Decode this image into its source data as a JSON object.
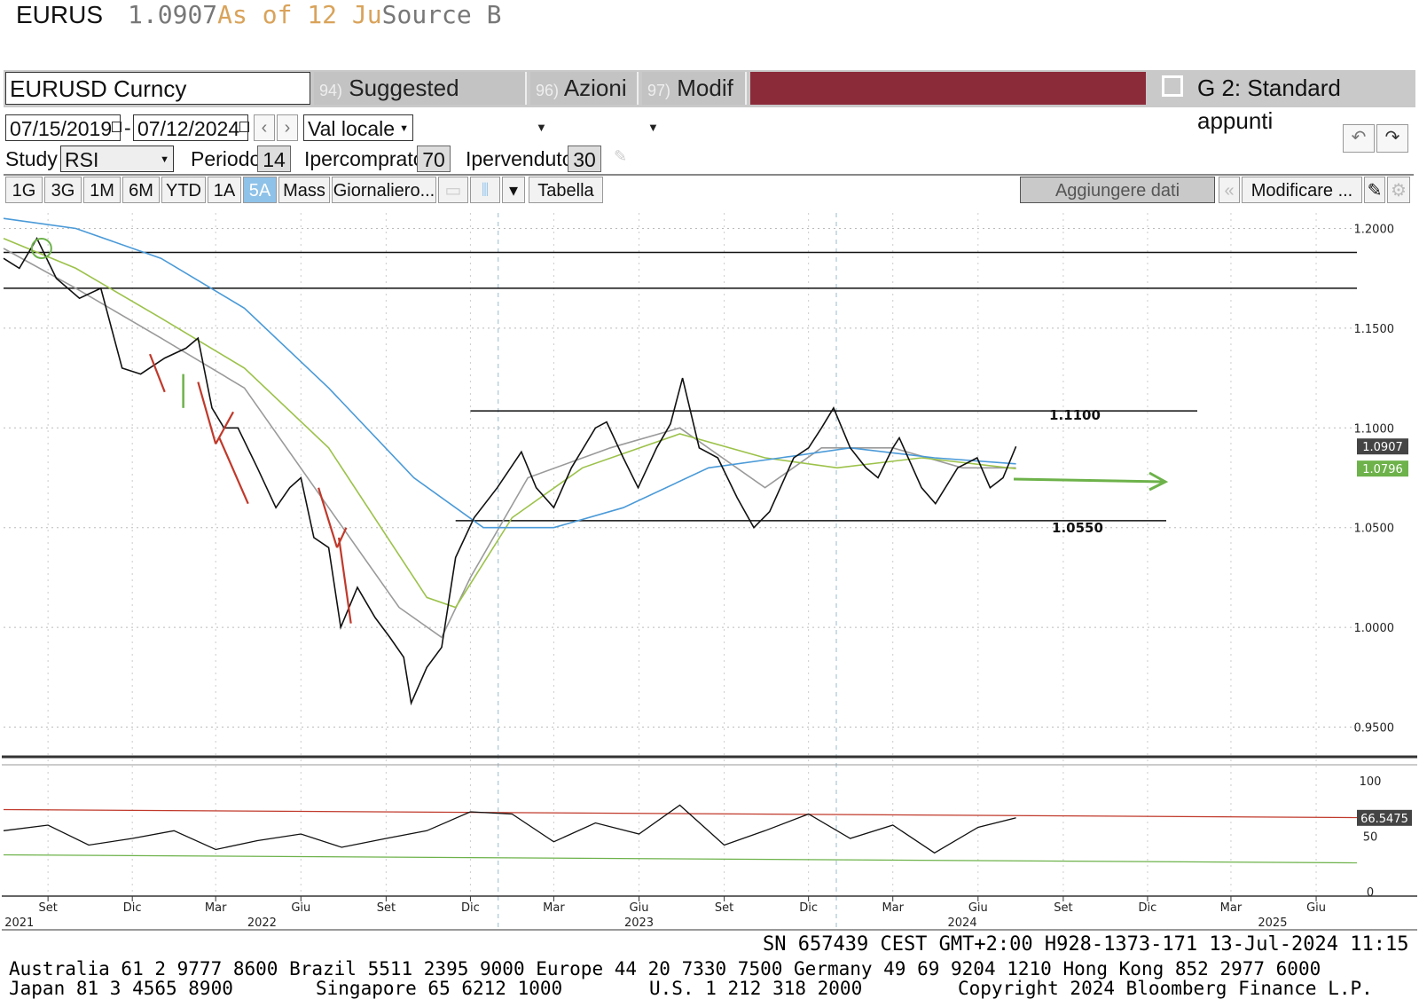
{
  "header": {
    "ticker": "EURUS",
    "price": "1.0907",
    "as_of": "As of 12 Ju",
    "source": "Source B"
  },
  "toolbar": {
    "security": "EURUSD Curncy",
    "suggested_num": "94)",
    "suggested": "Suggested Charts",
    "azioni_num": "96)",
    "azioni": "Azioni",
    "modif_num": "97)",
    "modif": "Modif",
    "template": "G 2: Standard appunti"
  },
  "controls": {
    "date_from": "07/15/2019",
    "date_to": "07/12/2024",
    "currency": "Val locale",
    "study_label": "Study",
    "study_value": "RSI",
    "periodo_label": "Periodo",
    "periodo_value": "14",
    "ipercomprato_label": "Ipercomprato",
    "ipercomprato_value": "70",
    "ipervenduto_label": "Ipervenduto",
    "ipervenduto_value": "30",
    "ranges": [
      "1G",
      "3G",
      "1M",
      "6M",
      "YTD",
      "1A",
      "5A",
      "Mass"
    ],
    "selected_range": "5A",
    "frequency": "Giornaliero...",
    "table": "Tabella",
    "add_data": "Aggiungere dati",
    "modify": "Modificare ..."
  },
  "chart_data": [
    {
      "type": "line",
      "title": "",
      "ylim": [
        0.94,
        1.21
      ],
      "y_ticks": [
        "1.2000",
        "1.1500",
        "1.1000",
        "1.0500",
        "1.0000",
        "0.9500"
      ],
      "y_tick_values": [
        1.2,
        1.15,
        1.1,
        1.05,
        1.0,
        0.95
      ],
      "x_ticks": [
        "Set",
        "Dic",
        "Mar",
        "Giu",
        "Set",
        "Dic",
        "Mar",
        "Giu",
        "Set",
        "Dic",
        "Mar",
        "Giu",
        "Set",
        "Dic",
        "Mar",
        "Giu"
      ],
      "x_tick_dates": [
        "2021-09-01",
        "2021-12-01",
        "2022-03-01",
        "2022-06-01",
        "2022-09-01",
        "2022-12-01",
        "2023-03-01",
        "2023-06-01",
        "2023-09-01",
        "2023-12-01",
        "2024-03-01",
        "2024-06-01",
        "2024-09-01",
        "2024-12-01",
        "2025-03-01",
        "2025-06-01"
      ],
      "years": [
        "2021",
        "2022",
        "2023",
        "2024",
        "2025"
      ],
      "year_dates": [
        "2021-08-01",
        "2022-04-20",
        "2023-06-01",
        "2024-05-15",
        "2025-04-15"
      ],
      "series": [
        {
          "x": [
            "2021-07-15",
            "2021-08-01",
            "2021-08-20",
            "2021-09-10",
            "2021-10-05",
            "2021-10-28",
            "2021-11-20",
            "2021-12-10",
            "2022-01-05",
            "2022-01-28",
            "2022-02-10",
            "2022-02-25",
            "2022-03-10",
            "2022-03-25",
            "2022-04-15",
            "2022-05-05",
            "2022-05-20",
            "2022-06-01",
            "2022-06-15",
            "2022-07-01",
            "2022-07-14",
            "2022-08-01",
            "2022-08-20",
            "2022-09-05",
            "2022-09-20",
            "2022-09-28",
            "2022-10-15",
            "2022-10-31",
            "2022-11-15",
            "2022-12-05",
            "2022-12-30",
            "2023-01-25",
            "2023-02-10",
            "2023-03-01",
            "2023-03-20",
            "2023-04-15",
            "2023-04-27",
            "2023-05-15",
            "2023-05-31",
            "2023-06-20",
            "2023-07-05",
            "2023-07-18",
            "2023-08-05",
            "2023-08-25",
            "2023-09-15",
            "2023-10-03",
            "2023-10-20",
            "2023-11-15",
            "2023-12-01",
            "2023-12-15",
            "2023-12-28",
            "2024-01-15",
            "2024-02-01",
            "2024-02-14",
            "2024-03-01",
            "2024-03-08",
            "2024-04-01",
            "2024-04-16",
            "2024-05-10",
            "2024-05-31",
            "2024-06-14",
            "2024-06-28",
            "2024-07-12"
          ],
          "values": [
            1.185,
            1.18,
            1.195,
            1.175,
            1.165,
            1.17,
            1.13,
            1.127,
            1.135,
            1.14,
            1.145,
            1.11,
            1.1,
            1.1,
            1.08,
            1.06,
            1.07,
            1.075,
            1.045,
            1.04,
            1.0,
            1.02,
            1.005,
            0.995,
            0.985,
            0.962,
            0.98,
            0.99,
            1.035,
            1.055,
            1.07,
            1.088,
            1.07,
            1.06,
            1.08,
            1.1,
            1.103,
            1.085,
            1.07,
            1.09,
            1.102,
            1.125,
            1.09,
            1.085,
            1.065,
            1.05,
            1.058,
            1.085,
            1.09,
            1.1,
            1.11,
            1.09,
            1.08,
            1.075,
            1.09,
            1.095,
            1.07,
            1.062,
            1.08,
            1.085,
            1.07,
            1.075,
            1.0907
          ]
        }
      ],
      "moving_averages": [
        {
          "color": "#9a9a9a",
          "x": [
            "2021-07-15",
            "2021-10-01",
            "2022-01-01",
            "2022-04-01",
            "2022-07-01",
            "2022-09-15",
            "2022-10-31",
            "2022-12-01",
            "2023-02-01",
            "2023-05-01",
            "2023-07-15",
            "2023-10-15",
            "2023-12-15",
            "2024-03-01",
            "2024-05-15",
            "2024-07-12"
          ],
          "values": [
            1.19,
            1.17,
            1.145,
            1.12,
            1.06,
            1.01,
            0.995,
            1.025,
            1.075,
            1.09,
            1.1,
            1.07,
            1.09,
            1.09,
            1.08,
            1.08
          ]
        },
        {
          "color": "#9cc24a",
          "x": [
            "2021-07-15",
            "2021-10-01",
            "2022-01-01",
            "2022-04-01",
            "2022-07-01",
            "2022-10-15",
            "2022-11-15",
            "2023-01-15",
            "2023-04-01",
            "2023-07-15",
            "2023-10-15",
            "2024-01-01",
            "2024-04-01",
            "2024-07-12"
          ],
          "values": [
            1.195,
            1.18,
            1.155,
            1.13,
            1.09,
            1.015,
            1.01,
            1.055,
            1.08,
            1.097,
            1.085,
            1.08,
            1.085,
            1.0796
          ]
        },
        {
          "color": "#4a9ad8",
          "x": [
            "2021-07-15",
            "2021-10-01",
            "2022-01-01",
            "2022-04-01",
            "2022-07-01",
            "2022-10-01",
            "2022-12-15",
            "2023-03-01",
            "2023-05-15",
            "2023-08-15",
            "2023-11-01",
            "2024-01-15",
            "2024-04-15",
            "2024-07-12"
          ],
          "values": [
            1.205,
            1.2,
            1.185,
            1.16,
            1.12,
            1.075,
            1.05,
            1.05,
            1.06,
            1.08,
            1.085,
            1.09,
            1.085,
            1.082
          ]
        }
      ],
      "levels": [
        {
          "label": "",
          "value": 1.188
        },
        {
          "label": "",
          "value": 1.17
        },
        {
          "label": "1.1100",
          "value": 1.1085
        },
        {
          "label": "1.0550",
          "value": 1.0535
        }
      ],
      "last_price_label": "1.0907",
      "ma_label": "1.0796",
      "last_price": 1.0907,
      "ma_value": 1.0796
    },
    {
      "type": "line",
      "title": "",
      "ylim": [
        0,
        100
      ],
      "y_ticks": [
        "100",
        "50",
        "0"
      ],
      "y_tick_values": [
        100,
        50,
        0
      ],
      "overbought": 70,
      "oversold": 30,
      "series": [
        {
          "x": [
            "2021-07-15",
            "2021-09-01",
            "2021-10-15",
            "2021-12-01",
            "2022-01-15",
            "2022-03-01",
            "2022-04-15",
            "2022-06-01",
            "2022-07-15",
            "2022-09-01",
            "2022-10-15",
            "2022-12-01",
            "2023-01-15",
            "2023-03-01",
            "2023-04-15",
            "2023-06-01",
            "2023-07-15",
            "2023-09-01",
            "2023-10-15",
            "2023-12-01",
            "2024-01-15",
            "2024-03-01",
            "2024-04-15",
            "2024-06-01",
            "2024-07-12"
          ],
          "values": [
            55,
            60,
            42,
            48,
            55,
            38,
            46,
            52,
            40,
            48,
            55,
            72,
            70,
            45,
            62,
            52,
            78,
            42,
            55,
            70,
            48,
            60,
            35,
            58,
            66.5475
          ]
        }
      ],
      "last_value_label": "66.5475",
      "last_value": 66.5475
    }
  ],
  "footer": {
    "sn_line": "SN 657439 CEST GMT+2:00 H928-1373-171 13-Jul-2024 11:15",
    "contacts_line1": "Australia 61 2 9777 8600 Brazil 5511 2395 9000 Europe 44 20 7330 7500 Germany 49 69 9204 1210 Hong Kong 852 2977 6000",
    "japan": "Japan 81 3 4565 8900",
    "singapore": "Singapore 65 6212 1000",
    "us": "U.S. 1 212 318 2000",
    "copyright": "Copyright 2024 Bloomberg Finance L.P."
  },
  "colors": {
    "toolbar_grey": "#c9c9c9",
    "maroon": "#8b2b3a",
    "selected_range": "#8fc2e8",
    "price_label": "#444444",
    "ma_label": "#6db24a",
    "rsi_overbought": "#c0392b",
    "rsi_oversold": "#6db24a",
    "arrow": "#6db24a"
  }
}
